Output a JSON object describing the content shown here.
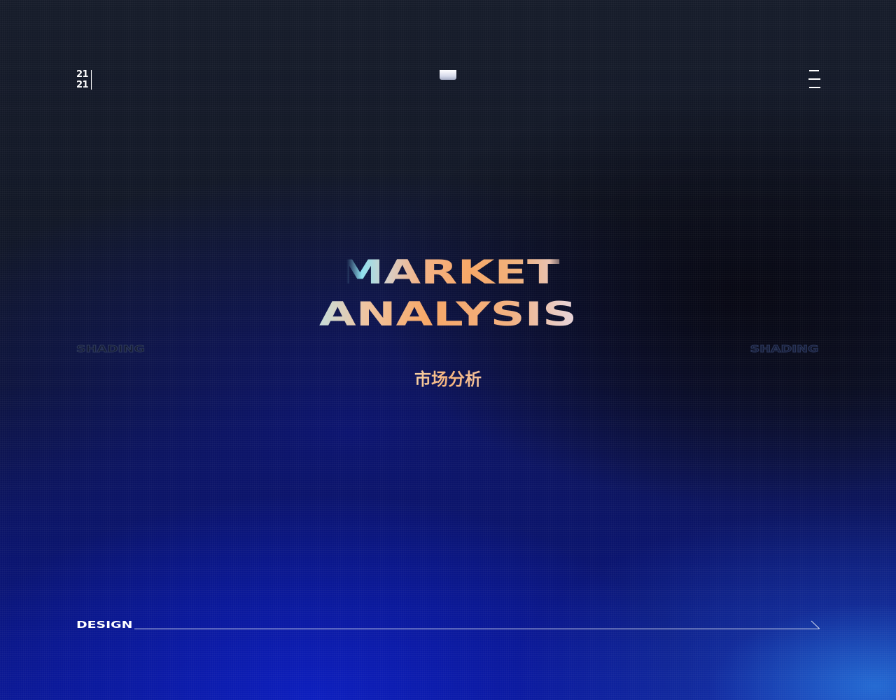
{
  "header": {
    "page_number_top": "21",
    "page_number_bottom": "21",
    "logo_icon": "logo-mark-icon",
    "menu_icon": "menu-icon"
  },
  "main": {
    "title_line1": "MARKET",
    "title_line2": "ANALYSIS",
    "subtitle_cn": "市场分析"
  },
  "side_labels": {
    "left": "SHADING",
    "right": "SHADING"
  },
  "footer": {
    "label": "DESIGN",
    "arrow_icon": "arrow-right-icon"
  },
  "colors": {
    "title_gradient_start": "#7fe6f2",
    "title_gradient_mid": "#f7a868",
    "title_gradient_end": "#f0e6ec",
    "background_top": "#161c2a",
    "background_bottom": "#0c1aa0",
    "glow_corner": "#2878dc"
  }
}
